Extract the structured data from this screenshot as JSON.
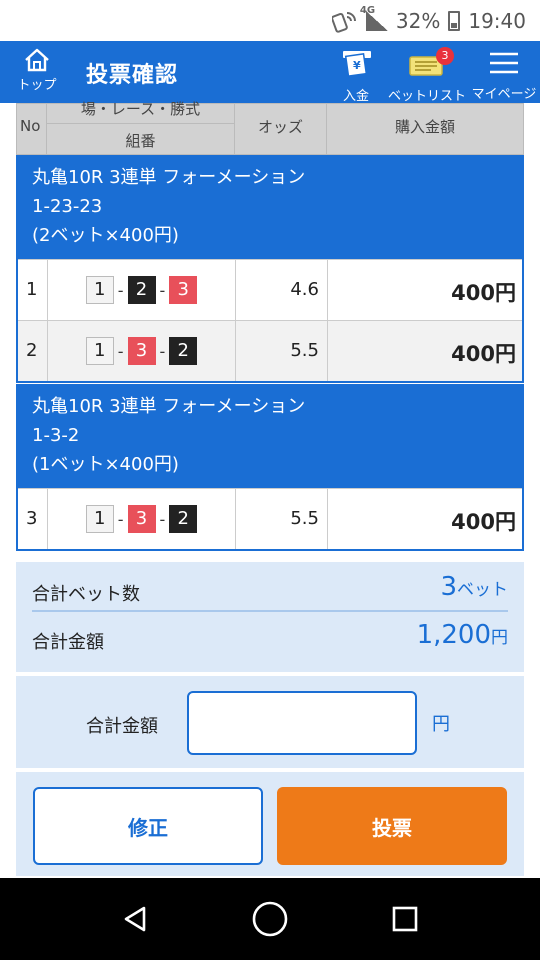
{
  "status_bar": {
    "network": "4G",
    "battery": "32%",
    "time": "19:40"
  },
  "header": {
    "home_label": "トップ",
    "title": "投票確認",
    "deposit_label": "入金",
    "betlist_label": "ベットリスト",
    "betlist_badge": "3",
    "mypage_label": "マイページ",
    "brand_color": "#1a6ed4"
  },
  "table": {
    "col_no": "No",
    "col_race_top": "場・レース・勝式",
    "col_race_bottom": "組番",
    "col_odds": "オッズ",
    "col_amount": "購入金額"
  },
  "groups": [
    {
      "title_line1": "丸亀10R 3連単 フォーメーション",
      "title_line2": "1-23-23",
      "title_line3": "(2ベット×400円)",
      "rows": [
        {
          "no": "1",
          "combo": [
            "1",
            "2",
            "3"
          ],
          "odds": "4.6",
          "amount": "400円"
        },
        {
          "no": "2",
          "combo": [
            "1",
            "3",
            "2"
          ],
          "odds": "5.5",
          "amount": "400円"
        }
      ]
    },
    {
      "title_line1": "丸亀10R 3連単 フォーメーション",
      "title_line2": "1-3-2",
      "title_line3": "(1ベット×400円)",
      "rows": [
        {
          "no": "3",
          "combo": [
            "1",
            "3",
            "2"
          ],
          "odds": "5.5",
          "amount": "400円"
        }
      ]
    }
  ],
  "summary": {
    "bet_count_label": "合計ベット数",
    "bet_count_value": "3",
    "bet_count_unit": "ベット",
    "total_label": "合計金額",
    "total_value": "1,200",
    "total_unit": "円"
  },
  "confirm": {
    "input_label": "合計金額",
    "input_value": "",
    "input_unit": "円"
  },
  "buttons": {
    "edit": "修正",
    "vote": "投票"
  },
  "boat_colors": {
    "1": "#f4f4f4",
    "2": "#222222",
    "3": "#e8505a"
  }
}
